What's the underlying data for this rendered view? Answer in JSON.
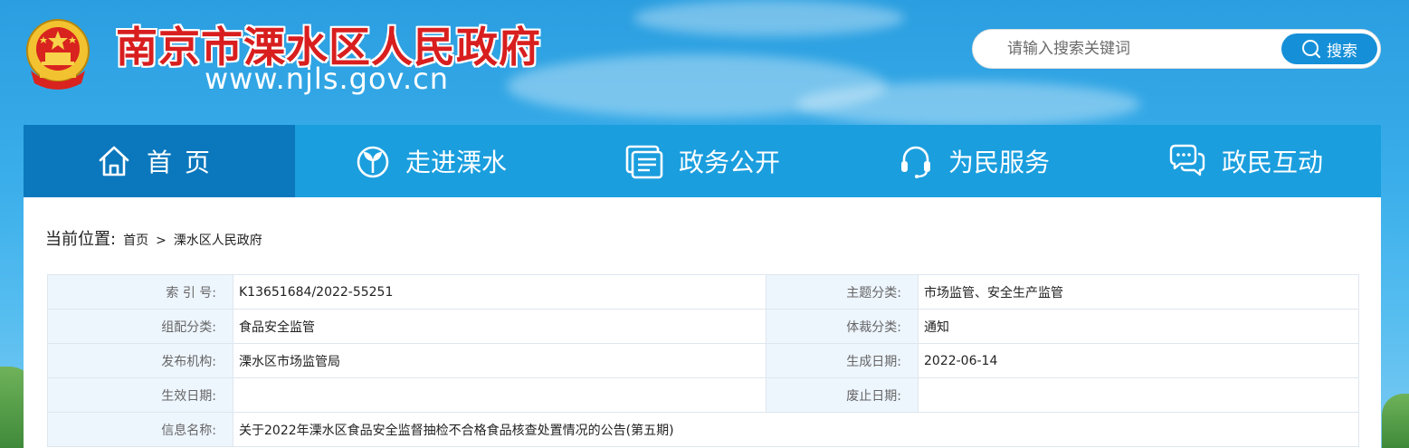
{
  "header": {
    "site_title": "南京市溧水区人民政府",
    "site_url": "www.njls.gov.cn",
    "emblem_icon": "national-emblem-icon"
  },
  "search": {
    "placeholder": "请输入搜索关键词",
    "button_label": "搜索",
    "button_icon": "search-icon"
  },
  "nav": {
    "items": [
      {
        "label": "首页",
        "icon": "home-icon",
        "active": true
      },
      {
        "label": "走进溧水",
        "icon": "sprout-icon",
        "active": false
      },
      {
        "label": "政务公开",
        "icon": "document-icon",
        "active": false
      },
      {
        "label": "为民服务",
        "icon": "headset-icon",
        "active": false
      },
      {
        "label": "政民互动",
        "icon": "chat-icon",
        "active": false
      }
    ]
  },
  "breadcrumb": {
    "label": "当前位置:",
    "items": [
      "首页",
      "溧水区人民政府"
    ],
    "separator": ">"
  },
  "info_table": {
    "rows": [
      {
        "k1": "索 引 号:",
        "v1": "K13651684/2022-55251",
        "k2": "主题分类:",
        "v2": "市场监管、安全生产监管"
      },
      {
        "k1": "组配分类:",
        "v1": "食品安全监管",
        "k2": "体裁分类:",
        "v2": "通知"
      },
      {
        "k1": "发布机构:",
        "v1": "溧水区市场监管局",
        "k2": "生成日期:",
        "v2": "2022-06-14"
      },
      {
        "k1": "生效日期:",
        "v1": "",
        "k2": "废止日期:",
        "v2": ""
      }
    ],
    "title_row": {
      "k": "信息名称:",
      "v": "关于2022年溧水区食品安全监督抽检不合格食品核查处置情况的公告(第五期)"
    }
  },
  "colors": {
    "nav_bg": "#1a9ede",
    "nav_active_bg": "#0b78bd",
    "title_red": "#d81e1e",
    "table_key_bg": "#edf5fd"
  }
}
